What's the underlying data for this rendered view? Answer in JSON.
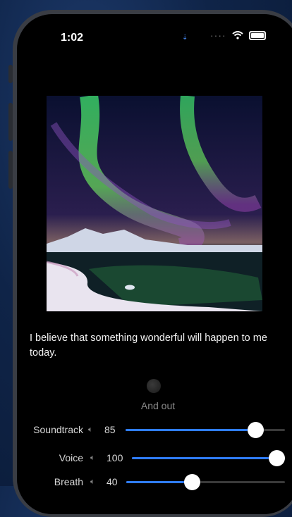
{
  "status_bar": {
    "time": "1:02",
    "location_glyph": "⇣",
    "signal_dots": "····"
  },
  "hero": {
    "alt": "aurora-over-frozen-lake",
    "accent_green": "#5ee86a",
    "accent_purple": "#9a4fb0"
  },
  "affirmation": {
    "text": "I believe that something wonderful will happen to me today."
  },
  "breath_indicator": {
    "label": "And out"
  },
  "mixer": {
    "accent": "#2f7dff",
    "channels": [
      {
        "label": "Soundtrack",
        "icon": "speaker-icon",
        "value": "85",
        "level": 0.85
      },
      {
        "label": "Voice",
        "icon": "speaker-icon",
        "value": "100",
        "level": 1.0
      },
      {
        "label": "Breath",
        "icon": "speaker-icon",
        "value": "40",
        "level": 0.4
      }
    ]
  }
}
